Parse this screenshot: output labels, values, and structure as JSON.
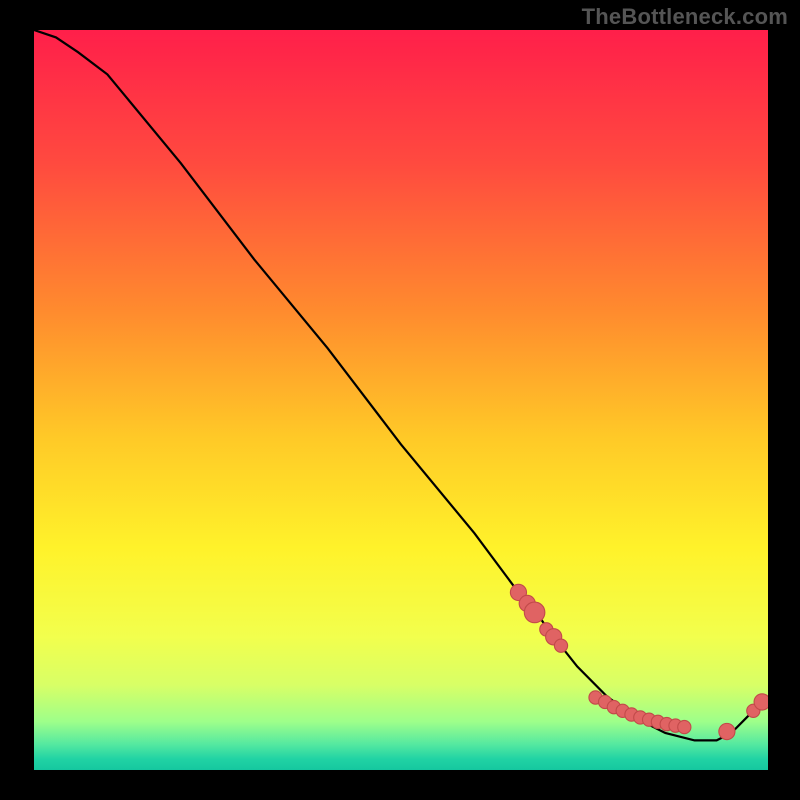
{
  "watermark": "TheBottleneck.com",
  "colors": {
    "bg": "#000000",
    "line": "#000000",
    "dot_fill": "#e06363",
    "dot_stroke": "#c24a4a",
    "gradient_stops": [
      {
        "offset": 0.0,
        "color": "#ff1f4a"
      },
      {
        "offset": 0.18,
        "color": "#ff4a3f"
      },
      {
        "offset": 0.38,
        "color": "#ff8b2e"
      },
      {
        "offset": 0.55,
        "color": "#ffc927"
      },
      {
        "offset": 0.7,
        "color": "#fff22a"
      },
      {
        "offset": 0.82,
        "color": "#f2ff4d"
      },
      {
        "offset": 0.885,
        "color": "#d8ff66"
      },
      {
        "offset": 0.935,
        "color": "#9dff8a"
      },
      {
        "offset": 0.965,
        "color": "#55e9a0"
      },
      {
        "offset": 0.985,
        "color": "#21d3a4"
      },
      {
        "offset": 1.0,
        "color": "#15c79f"
      }
    ]
  },
  "chart_data": {
    "type": "line",
    "title": "",
    "xlabel": "",
    "ylabel": "",
    "xlim": [
      0,
      100
    ],
    "ylim": [
      0,
      100
    ],
    "grid": false,
    "legend": false,
    "series": [
      {
        "name": "curve",
        "x": [
          0,
          3,
          6,
          10,
          20,
          30,
          40,
          50,
          60,
          66,
          68,
          70,
          74,
          78,
          82,
          86,
          90,
          93,
          95,
          97,
          100
        ],
        "y": [
          100,
          99,
          97,
          94,
          82,
          69,
          57,
          44,
          32,
          24,
          22,
          19,
          14,
          10,
          7,
          5,
          4,
          4,
          5,
          7,
          10
        ]
      }
    ],
    "scatter": [
      {
        "name": "dots",
        "points": [
          {
            "x": 66.0,
            "y": 24.0,
            "r": 1.1
          },
          {
            "x": 67.2,
            "y": 22.5,
            "r": 1.1
          },
          {
            "x": 68.2,
            "y": 21.3,
            "r": 1.4
          },
          {
            "x": 69.8,
            "y": 19.0,
            "r": 0.9
          },
          {
            "x": 70.8,
            "y": 18.0,
            "r": 1.1
          },
          {
            "x": 71.8,
            "y": 16.8,
            "r": 0.9
          },
          {
            "x": 76.5,
            "y": 9.8,
            "r": 0.9
          },
          {
            "x": 77.8,
            "y": 9.2,
            "r": 0.9
          },
          {
            "x": 79.0,
            "y": 8.5,
            "r": 0.9
          },
          {
            "x": 80.2,
            "y": 8.0,
            "r": 0.9
          },
          {
            "x": 81.4,
            "y": 7.5,
            "r": 0.9
          },
          {
            "x": 82.6,
            "y": 7.1,
            "r": 0.9
          },
          {
            "x": 83.8,
            "y": 6.8,
            "r": 0.9
          },
          {
            "x": 85.0,
            "y": 6.5,
            "r": 0.9
          },
          {
            "x": 86.2,
            "y": 6.2,
            "r": 0.9
          },
          {
            "x": 87.4,
            "y": 6.0,
            "r": 0.9
          },
          {
            "x": 88.6,
            "y": 5.8,
            "r": 0.9
          },
          {
            "x": 94.4,
            "y": 5.2,
            "r": 1.1
          },
          {
            "x": 98.0,
            "y": 8.0,
            "r": 0.9
          },
          {
            "x": 99.2,
            "y": 9.2,
            "r": 1.1
          }
        ]
      }
    ]
  }
}
